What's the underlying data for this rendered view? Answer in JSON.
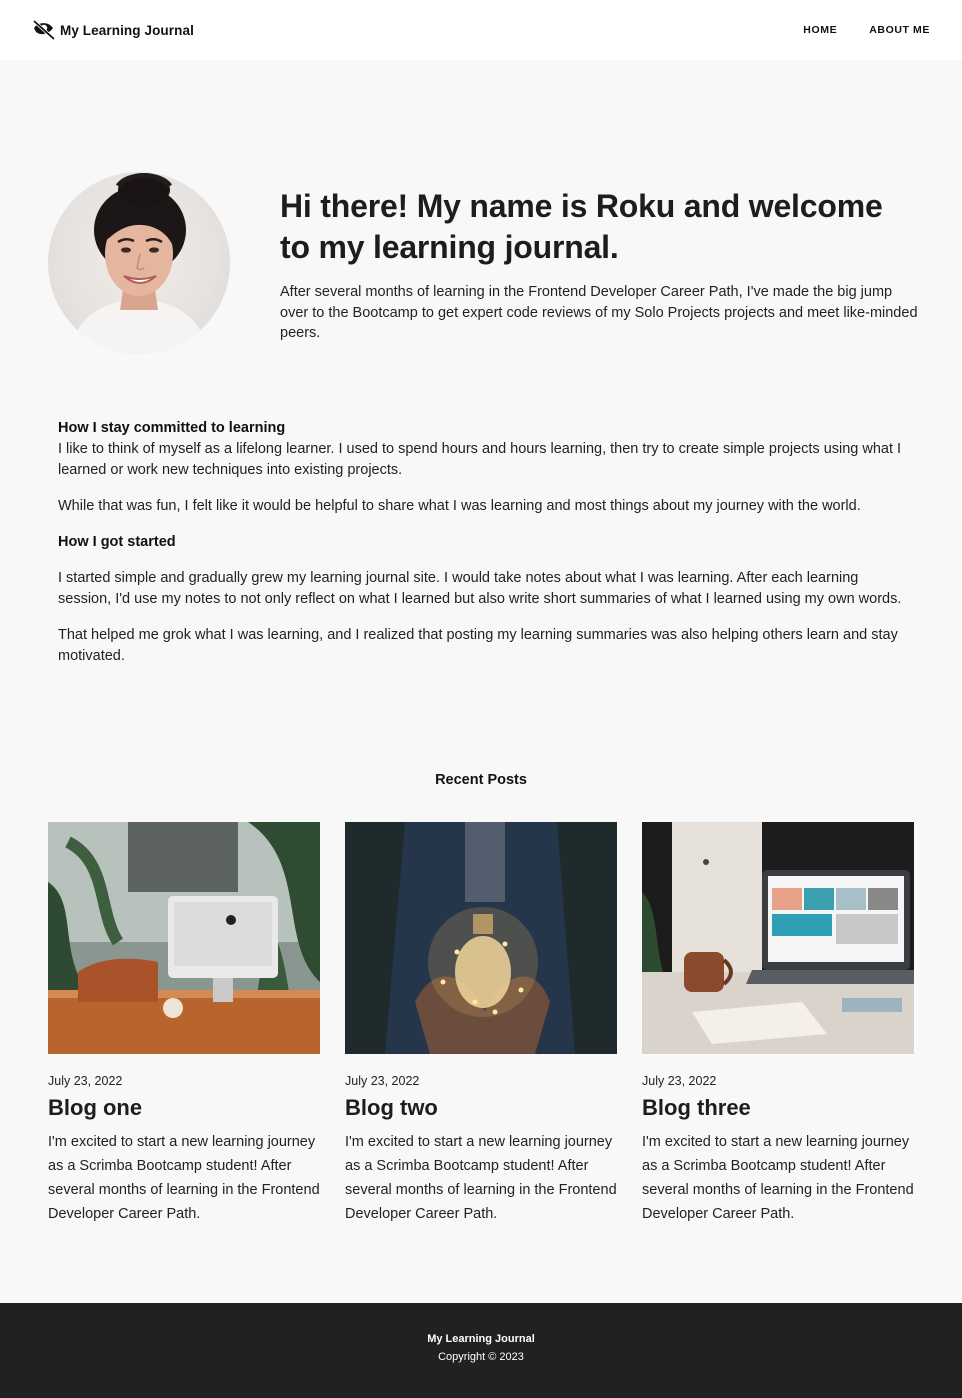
{
  "header": {
    "brand_name": "My Learning Journal",
    "brand_icon": "eye-slash-icon",
    "nav": [
      {
        "label": "HOME"
      },
      {
        "label": "ABOUT ME"
      }
    ]
  },
  "hero": {
    "avatar_alt": "profile-photo",
    "title": "Hi there! My name is Roku and welcome to my learning journal.",
    "description": "After several months of learning in the Frontend Developer Career Path, I've made the big jump over to the Bootcamp to get expert code reviews of my Solo Projects projects and meet like-minded peers."
  },
  "about": {
    "heading1": "How I stay committed to learning",
    "p1": "I like to think of myself as a lifelong learner. I used to spend hours and hours learning, then try to create simple projects using what I learned or work new techniques into existing projects.",
    "p2": "While that was fun, I felt like it would be helpful to share what I was learning and most things about my journey with the world.",
    "heading2": "How I got started",
    "p3": "I started simple and gradually grew my learning journal site. I would take notes about what I was learning. After each learning session, I'd use my notes to not only reflect on what I learned but also write short summaries of what I learned using my own words.",
    "p4": "That helped me grok what I was learning, and I realized that posting my learning summaries was also helping others learn and stay motivated."
  },
  "recent": {
    "title": "Recent Posts",
    "posts": [
      {
        "date": "July 23, 2022",
        "title": "Blog one",
        "excerpt": "I'm excited to start a new learning journey as a Scrimba Bootcamp student! After several months of learning in the Frontend Developer Career Path."
      },
      {
        "date": "July 23, 2022",
        "title": "Blog two",
        "excerpt": "I'm excited to start a new learning journey as a Scrimba Bootcamp student! After several months of learning in the Frontend Developer Career Path."
      },
      {
        "date": "July 23, 2022",
        "title": "Blog three",
        "excerpt": "I'm excited to start a new learning journey as a Scrimba Bootcamp student! After several months of learning in the Frontend Developer Career Path."
      }
    ]
  },
  "footer": {
    "name": "My Learning Journal",
    "copyright": "Copyright © 2023"
  },
  "colors": {
    "background": "#f8f8f8",
    "header": "#ffffff",
    "footer": "#212121",
    "text": "#1f1f1f"
  }
}
